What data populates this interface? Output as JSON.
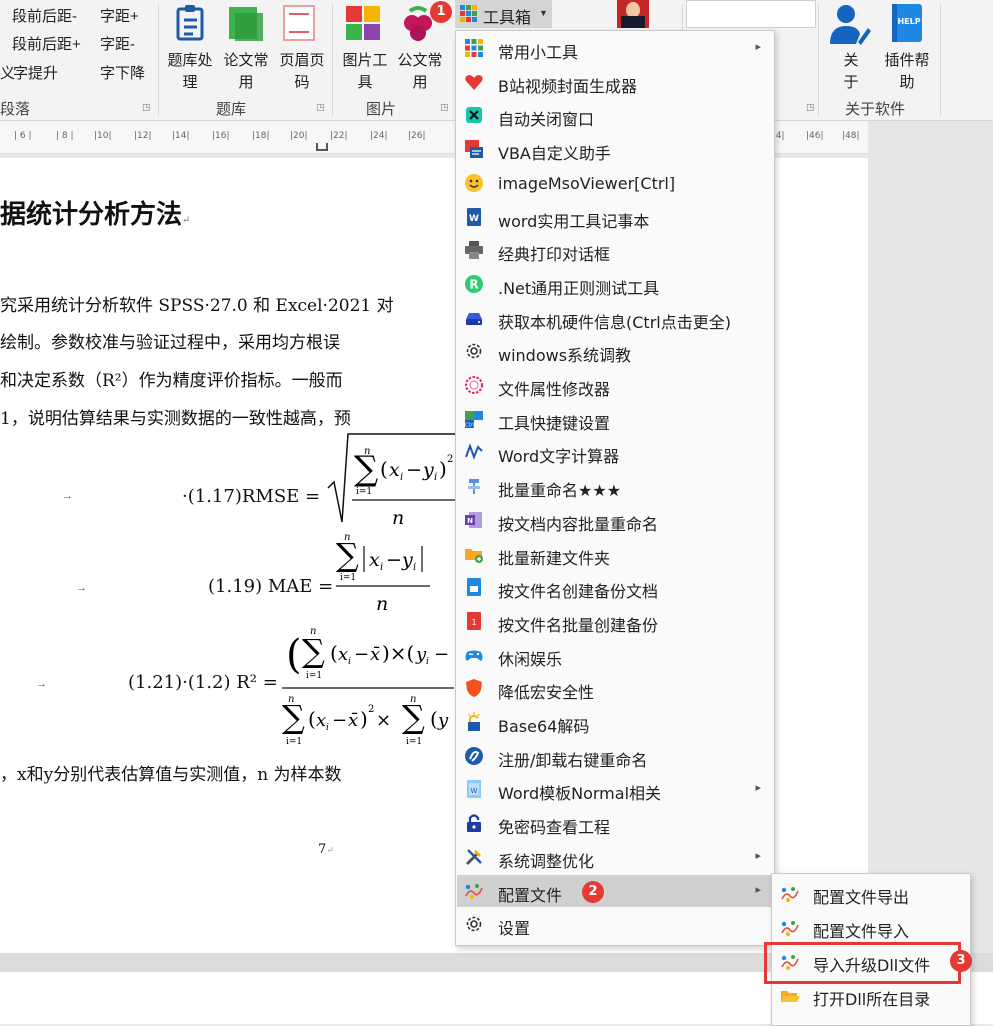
{
  "ribbon": {
    "para_items": [
      "段前后距-",
      "段前后距+",
      "字提升",
      "字距+",
      "字距-",
      "字下降"
    ],
    "para_prefix": "义",
    "group_paragraph": "段落",
    "tiku_buttons": [
      "题库处\n理",
      "论文常\n用",
      "页眉页\n码"
    ],
    "group_tiku": "题库",
    "pic_buttons": [
      "图片工\n具",
      "公文常\n用"
    ],
    "group_pic": "图片",
    "toolbox_label": "工具箱",
    "about_buttons": [
      "关\n于",
      "插件帮\n助"
    ],
    "help_icon_text": "HELP",
    "group_about": "关于软件"
  },
  "ruler": {
    "ticks": [
      "6",
      "8",
      "10",
      "12",
      "14",
      "16",
      "18",
      "20",
      "22",
      "24",
      "26",
      "44",
      "46",
      "48"
    ]
  },
  "document": {
    "heading": "据统计分析方法",
    "para_lines": [
      "究采用统计分析软件 SPSS·27.0 和 Excel·2021 对",
      "绘制。参数校准与验证过程中，采用均方根误",
      "和决定系数（R²）作为精度评价指标。一般而",
      "1，说明估算结果与实测数据的一致性越高，预"
    ],
    "eq1_label": "·(1.17)RMSE =",
    "eq2_label": "(1.19) MAE =",
    "eq3_label": "(1.21)·(1.2) R² =",
    "tail_line": "，x和y分别代表估算值与实测值，n 为样本数",
    "page_number": "7"
  },
  "menu": {
    "items": [
      {
        "label": "常用小工具",
        "icon": "grid-tools-icon",
        "submenu": true
      },
      {
        "label": "B站视频封面生成器",
        "icon": "heart-icon",
        "submenu": false
      },
      {
        "label": "自动关闭窗口",
        "icon": "close-window-icon",
        "submenu": false
      },
      {
        "label": "VBA自定义助手",
        "icon": "vba-icon",
        "submenu": false
      },
      {
        "label": "imageMsoViewer[Ctrl]",
        "icon": "smiley-icon",
        "submenu": false
      },
      {
        "label": "word实用工具记事本",
        "icon": "word-doc-icon",
        "submenu": false
      },
      {
        "label": "经典打印对话框",
        "icon": "printer-icon",
        "submenu": false
      },
      {
        "label": ".Net通用正则测试工具",
        "icon": "regex-icon",
        "submenu": false
      },
      {
        "label": "获取本机硬件信息(Ctrl点击更全)",
        "icon": "hardware-icon",
        "submenu": false
      },
      {
        "label": "windows系统调教",
        "icon": "gear-icon",
        "submenu": false
      },
      {
        "label": "文件属性修改器",
        "icon": "badge-icon",
        "submenu": false
      },
      {
        "label": "工具快捷键设置",
        "icon": "shortcut-icon",
        "submenu": false
      },
      {
        "label": "Word文字计算器",
        "icon": "calculator-icon",
        "submenu": false
      },
      {
        "label": "批量重命名★★★",
        "icon": "rename-icon",
        "submenu": false
      },
      {
        "label": "按文档内容批量重命名",
        "icon": "onenote-icon",
        "submenu": false
      },
      {
        "label": "批量新建文件夹",
        "icon": "new-folder-icon",
        "submenu": false
      },
      {
        "label": "按文件名创建备份文档",
        "icon": "backup-doc-icon",
        "submenu": false
      },
      {
        "label": "按文件名批量创建备份",
        "icon": "batch-backup-icon",
        "submenu": false
      },
      {
        "label": "休闲娱乐",
        "icon": "gamepad-icon",
        "submenu": false
      },
      {
        "label": "降低宏安全性",
        "icon": "shield-icon",
        "submenu": false
      },
      {
        "label": "Base64解码",
        "icon": "lock-light-icon",
        "submenu": false
      },
      {
        "label": "注册/卸载右键重命名",
        "icon": "register-icon",
        "submenu": false
      },
      {
        "label": "Word模板Normal相关",
        "icon": "template-icon",
        "submenu": true
      },
      {
        "label": "免密码查看工程",
        "icon": "unlock-icon",
        "submenu": false
      },
      {
        "label": "系统调整优化",
        "icon": "tools-icon",
        "submenu": true
      },
      {
        "label": "配置文件",
        "icon": "config-icon",
        "submenu": true
      },
      {
        "label": "设置",
        "icon": "settings-icon",
        "submenu": false
      }
    ],
    "highlighted_index": 25
  },
  "submenu": {
    "items": [
      {
        "label": "配置文件导出",
        "icon": "config-export-icon"
      },
      {
        "label": "配置文件导入",
        "icon": "config-import-icon"
      },
      {
        "label": "导入升级Dll文件",
        "icon": "dll-import-icon"
      },
      {
        "label": "打开Dll所在目录",
        "icon": "folder-open-icon"
      }
    ]
  },
  "badges": [
    "1",
    "2",
    "3"
  ],
  "colors": {
    "badge": "#e53935",
    "highlight": "#d0d0d0",
    "accent_blue": "#1e5aa8"
  }
}
